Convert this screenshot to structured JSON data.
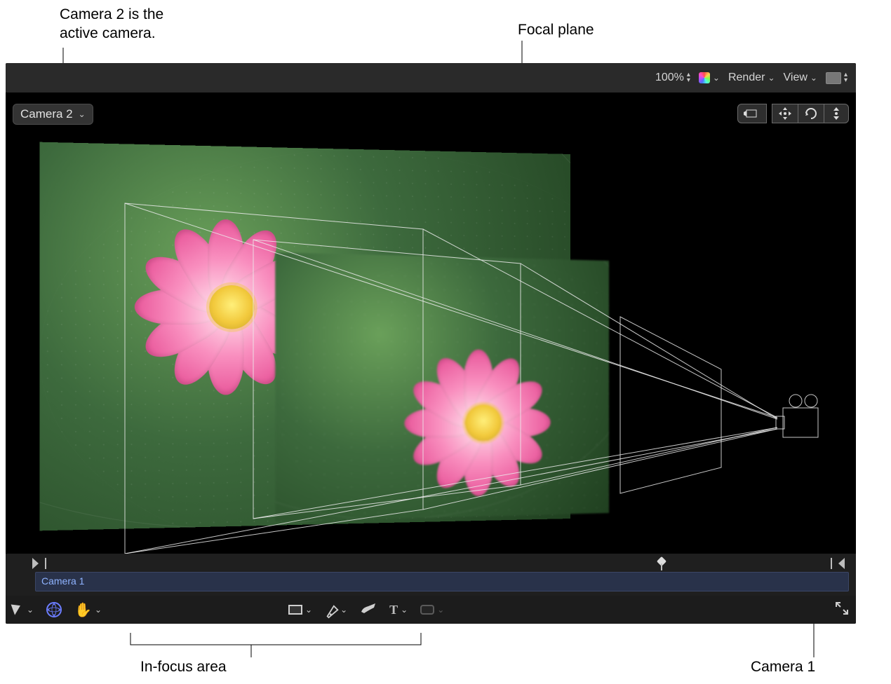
{
  "annotations": {
    "active_camera_note": "Camera 2 is the\nactive camera.",
    "focal_plane": "Focal plane",
    "in_focus_area": "In-focus area",
    "camera1": "Camera 1"
  },
  "toolbar": {
    "zoom": "100%",
    "render": "Render",
    "view": "View"
  },
  "overlay": {
    "camera_menu": "Camera 2"
  },
  "timeline": {
    "row_label": "Camera 1"
  },
  "bottom": {
    "text_T": "T"
  }
}
